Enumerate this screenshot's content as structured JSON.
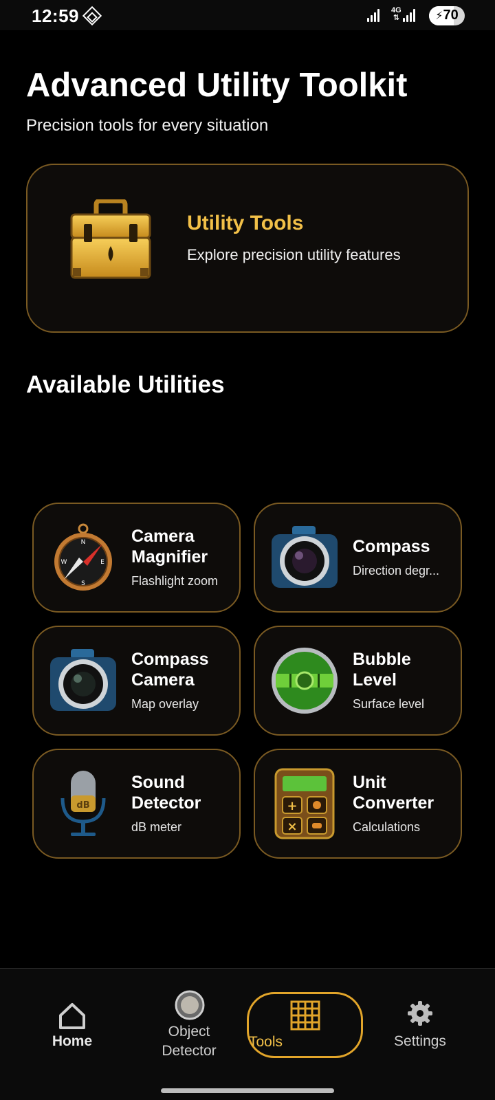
{
  "status_bar": {
    "time": "12:59",
    "network": "4G",
    "battery": "70",
    "battery_fraction": 0.7
  },
  "header": {
    "title": "Advanced Utility Toolkit",
    "subtitle": "Precision tools for every situation"
  },
  "hero": {
    "title": "Utility Tools",
    "description": "Explore precision utility features",
    "icon": "toolbox-icon"
  },
  "section_title": "Available Utilities",
  "utilities": [
    {
      "title": "Camera Magnifier",
      "subtitle": "Flashlight zoom",
      "icon": "compass-icon"
    },
    {
      "title": "Compass",
      "subtitle": "Direction degr...",
      "icon": "camera-icon"
    },
    {
      "title": "Compass Camera",
      "subtitle": "Map overlay",
      "icon": "camera-icon"
    },
    {
      "title": "Bubble Level",
      "subtitle": "Surface level",
      "icon": "bubble-level-icon"
    },
    {
      "title": "Sound Detector",
      "subtitle": "dB meter",
      "icon": "microphone-icon"
    },
    {
      "title": "Unit Converter",
      "subtitle": "Calculations",
      "icon": "calculator-icon"
    }
  ],
  "nav": {
    "home": "Home",
    "object_detector": "Object Detector",
    "tools": "Tools",
    "settings": "Settings",
    "active": "tools"
  },
  "colors": {
    "accent": "#f2c048",
    "card_border": "#7a5a22",
    "nav_active_border": "#e2a52a",
    "background": "#000000"
  }
}
